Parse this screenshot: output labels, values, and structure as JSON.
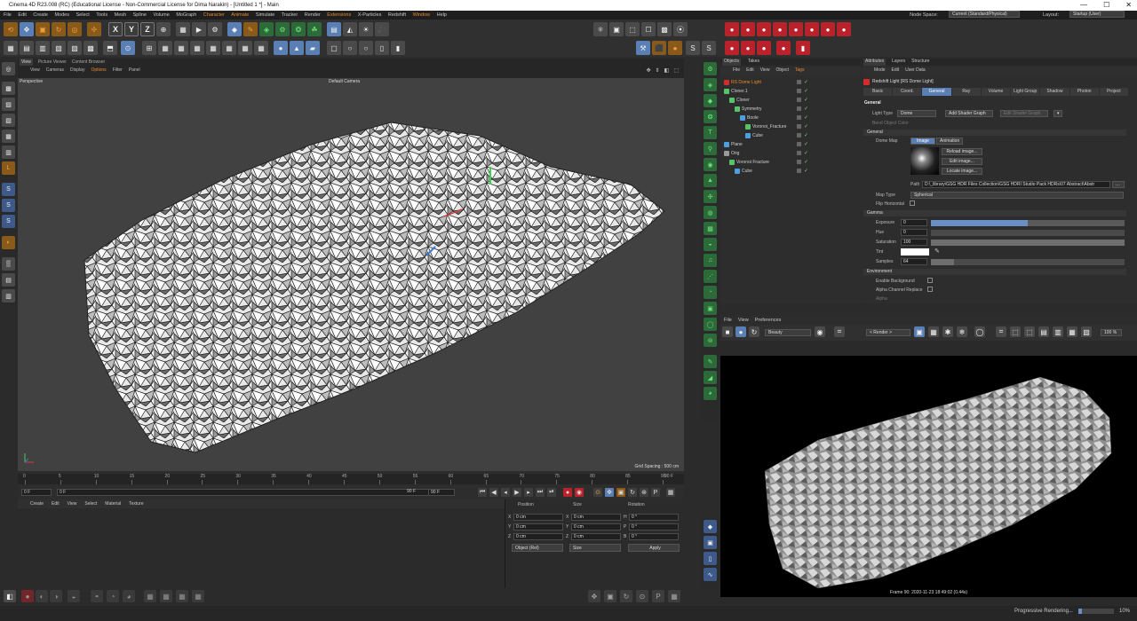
{
  "window": {
    "title": "Cinema 4D R23.008 (RC) (Educational License - Non-Commercial License for Dima Narakin) - [Untitled 1 *] - Main",
    "controls": [
      "—",
      "☐",
      "✕"
    ]
  },
  "menubar": {
    "items": [
      "File",
      "Edit",
      "Create",
      "Modes",
      "Select",
      "Tools",
      "Mesh",
      "Spline",
      "Volume",
      "MoGraph",
      "Character",
      "Animate",
      "Simulate",
      "Tracker",
      "Render",
      "Extensions",
      "X-Particles",
      "Redshift",
      "Window",
      "Help"
    ],
    "node_space_label": "Node Space:",
    "node_space_value": "Current (Standard/Physical)",
    "layout_label": "Layout:",
    "layout_value": "Startup (User)"
  },
  "viewport": {
    "tabs": [
      "View",
      "Picture Viewer",
      "Content Browser"
    ],
    "menus": [
      "View",
      "Cameras",
      "Display",
      "Options",
      "Filter",
      "Panel"
    ],
    "label": "Perspective",
    "camera": "Default Camera",
    "grid_spacing": "Grid Spacing : 500 cm",
    "nav_icons": [
      "✥",
      "⇕",
      "◧",
      "⬚"
    ]
  },
  "timeline": {
    "ticks": [
      "0",
      "5",
      "10",
      "15",
      "20",
      "25",
      "30",
      "35",
      "40",
      "45",
      "50",
      "55",
      "60",
      "65",
      "70",
      "75",
      "80",
      "85",
      "90"
    ],
    "start_field": "0 F",
    "current_field": "0 F",
    "end_field": "90 F",
    "end_field2": "90 F",
    "end_label": "90 F"
  },
  "material_menu": [
    "Create",
    "Edit",
    "View",
    "Select",
    "Material",
    "Texture"
  ],
  "coordinates": {
    "headers": [
      "Position",
      "Size",
      "Rotation"
    ],
    "rows": [
      {
        "axis": "X",
        "pos": "0 cm",
        "saxis": "X",
        "size": "0 cm",
        "raxis": "H",
        "rot": "0 °"
      },
      {
        "axis": "Y",
        "pos": "0 cm",
        "saxis": "Y",
        "size": "0 cm",
        "raxis": "P",
        "rot": "0 °"
      },
      {
        "axis": "Z",
        "pos": "0 cm",
        "saxis": "Z",
        "size": "0 cm",
        "raxis": "B",
        "rot": "0 °"
      }
    ],
    "mode": "Object (Rel)",
    "size_mode": "Size",
    "apply": "Apply"
  },
  "objects": {
    "tabs": [
      "Objects",
      "Takes"
    ],
    "menus": [
      "File",
      "Edit",
      "View",
      "Object",
      "Tags"
    ],
    "items": [
      {
        "name": "RS Dome Light",
        "indent": 0,
        "color": "#d52b2b",
        "name_color": "#e88a2b"
      },
      {
        "name": "Cloner.1",
        "indent": 0,
        "color": "#58c46a",
        "name_color": "#cfcfcf"
      },
      {
        "name": "Cloner",
        "indent": 1,
        "color": "#58c46a",
        "name_color": "#cfcfcf"
      },
      {
        "name": "Symmetry",
        "indent": 2,
        "color": "#58c46a",
        "name_color": "#cfcfcf"
      },
      {
        "name": "Boole",
        "indent": 3,
        "color": "#4aa0e0",
        "name_color": "#cfcfcf"
      },
      {
        "name": "Voronoi_Fracture",
        "indent": 4,
        "color": "#58c46a",
        "name_color": "#cfcfcf"
      },
      {
        "name": "Cube",
        "indent": 4,
        "color": "#4aa0e0",
        "name_color": "#cfcfcf"
      },
      {
        "name": "Plane",
        "indent": 0,
        "color": "#4aa0e0",
        "name_color": "#cfcfcf"
      },
      {
        "name": "Orig",
        "indent": 0,
        "color": "#999999",
        "name_color": "#cfcfcf"
      },
      {
        "name": "Voronoi Fracture",
        "indent": 1,
        "color": "#58c46a",
        "name_color": "#cfcfcf"
      },
      {
        "name": "Cube",
        "indent": 2,
        "color": "#4aa0e0",
        "name_color": "#cfcfcf"
      }
    ]
  },
  "attributes": {
    "tabs": [
      "Attributes",
      "Layers",
      "Structure"
    ],
    "menus": [
      "Mode",
      "Edit",
      "User Data"
    ],
    "title": "Redshift Light [RS Dome Light]",
    "subtabs": [
      "Basic",
      "Coord.",
      "General",
      "Ray",
      "Volume",
      "Light Group",
      "Shadow",
      "Photon",
      "Project"
    ],
    "active_subtab": "General",
    "general_header": "General",
    "light_type_label": "Light Type",
    "light_type_value": "Dome",
    "add_shader_graph": "Add Shader Graph",
    "edit_shader_graph": "Edit Shader Graph",
    "bend_object_color": "Bend Object Color",
    "sub_general": "General",
    "dome_map_label": "Dome Map",
    "image_tab": "Image",
    "animation_tab": "Animation",
    "reload_image": "Reload image...",
    "edit_image": "Edit image...",
    "locate_image": "Locate image...",
    "path_label": "Path",
    "path_value": "D:\\_library\\GSG HDR Files Collection\\GSG HDRI Studio Pack HDRs\\07 Abstract\\Abstr",
    "map_type_label": "Map Type",
    "map_type_value": "Spherical",
    "flip_horizontal": "Flip Horizontal",
    "gamma_header": "Gamma",
    "exposure_label": "Exposure",
    "exposure_value": "0",
    "hue_label": "Hue",
    "hue_value": "0",
    "saturation_label": "Saturation",
    "saturation_value": "100",
    "tint_label": "Tint",
    "samples_label": "Samples",
    "samples_value": "64",
    "exposure_fill": 0.5,
    "saturation_fill": 1.0,
    "samples_fill": 0.12,
    "environment_header": "Environment",
    "enable_background": "Enable Background",
    "alpha_channel_replace": "Alpha Channel Replace",
    "alpha": "Alpha"
  },
  "render_view": {
    "menus": [
      "File",
      "View",
      "Preferences"
    ],
    "aov": "Beauty",
    "render_target": "< Render >",
    "zoom": "100 %",
    "caption": "Frame 90:  2020-11-23  18:49:02  (0.44s)"
  },
  "status": {
    "text": "Progressive Rendering...",
    "progress": "10%",
    "progress_fill": 0.1
  },
  "colors": {
    "accent": "#e88a2b",
    "highlight": "#5a7fb5",
    "bg": "#2b2b2b",
    "viewport": "#414141"
  }
}
